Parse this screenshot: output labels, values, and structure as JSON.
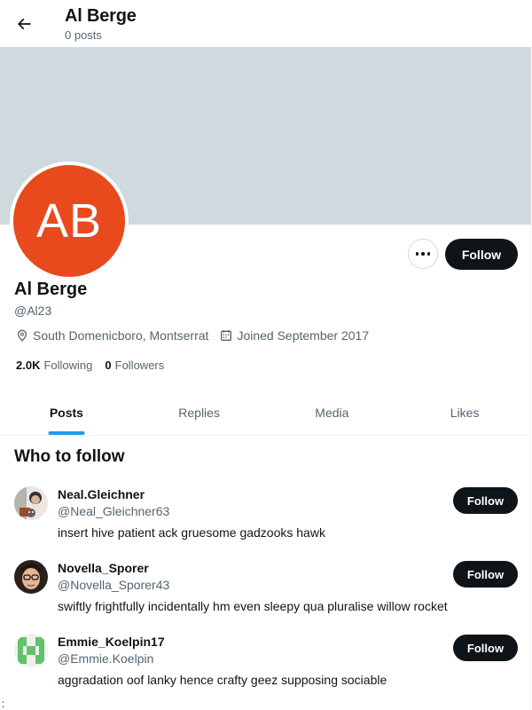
{
  "header": {
    "name": "Al Berge",
    "post_count": "0 posts"
  },
  "profile": {
    "avatar_initials": "AB",
    "avatar_color": "#e8491d",
    "banner_color": "#cfd9de",
    "name": "Al Berge",
    "handle": "@Al23",
    "location": "South Domenicboro, Montserrat",
    "joined": "Joined September 2017",
    "following_count": "2.0K",
    "following_label": "Following",
    "followers_count": "0",
    "followers_label": "Followers",
    "follow_label": "Follow"
  },
  "tabs": [
    {
      "label": "Posts",
      "active": true
    },
    {
      "label": "Replies",
      "active": false
    },
    {
      "label": "Media",
      "active": false
    },
    {
      "label": "Likes",
      "active": false
    }
  ],
  "who_to_follow": {
    "title": "Who to follow",
    "follow_label": "Follow",
    "users": [
      {
        "name": "Neal.Gleichner",
        "handle": "@Neal_Gleichner63",
        "bio": "insert hive patient ack gruesome gadzooks hawk"
      },
      {
        "name": "Novella_Sporer",
        "handle": "@Novella_Sporer43",
        "bio": "swiftly frightfully incidentally hm even sleepy qua pluralise willow rocket"
      },
      {
        "name": "Emmie_Koelpin17",
        "handle": "@Emmie.Koelpin",
        "bio": "aggradation oof lanky hence crafty geez supposing sociable"
      }
    ]
  },
  "footer_glyph": ":",
  "accent_color": "#1d9bf0"
}
